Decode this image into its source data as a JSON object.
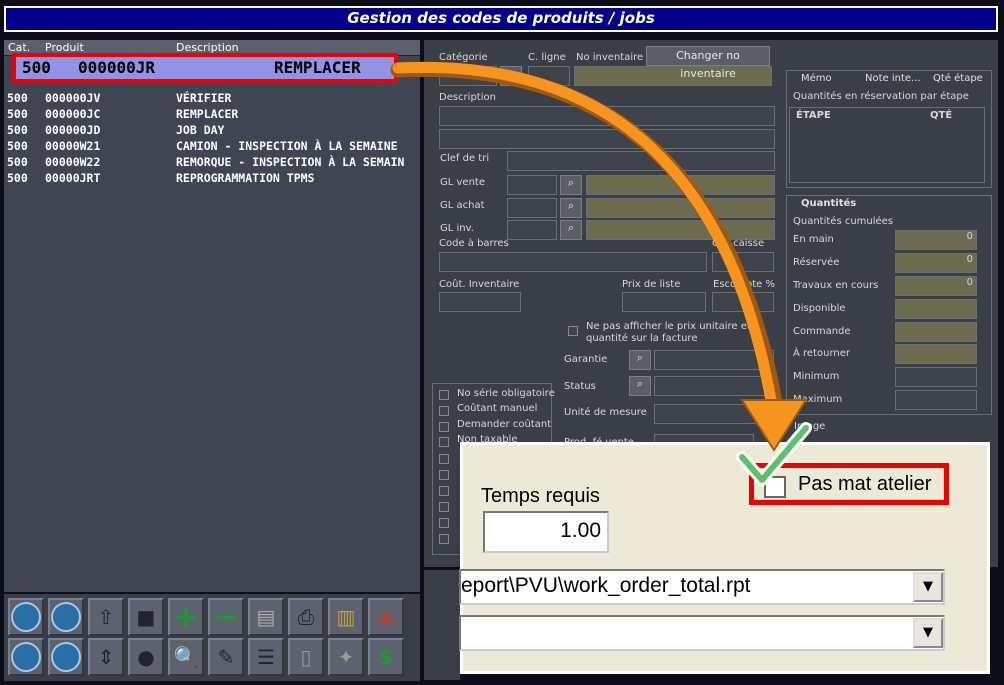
{
  "title": "Gestion des codes de produits / jobs",
  "list": {
    "headers": {
      "cat": "Cat.",
      "produit": "Produit",
      "description": "Description"
    },
    "selected": {
      "cat": "500",
      "produit": "000000JR",
      "description": "REMPLACER"
    },
    "rows": [
      {
        "cat": "500",
        "produit": "000000JV",
        "description": "VÉRIFIER"
      },
      {
        "cat": "500",
        "produit": "000000JC",
        "description": "REMPLACER"
      },
      {
        "cat": "500",
        "produit": "000000JD",
        "description": "JOB DAY"
      },
      {
        "cat": "500",
        "produit": "00000W21",
        "description": "CAMION - INSPECTION À LA SEMAINE"
      },
      {
        "cat": "500",
        "produit": "00000W22",
        "description": "REMORQUE - INSPECTION À LA SEMAIN"
      },
      {
        "cat": "500",
        "produit": "00000JRT",
        "description": "REPROGRAMMATION TPMS"
      }
    ]
  },
  "form": {
    "categorie": "Catégorie",
    "c_ligne": "C. ligne",
    "no_inventaire": "No inventaire",
    "changer_no_inventaire": "Changer no inventaire",
    "description": "Description",
    "clef_de_tri": "Clef de tri",
    "gl_vente": "GL vente",
    "gl_achat": "GL achat",
    "gl_inv": "GL inv.",
    "code_a_barres": "Code à barres",
    "qte_caisse": "Qté caisse",
    "cout_inventaire": "Coût. Inventaire",
    "prix_de_liste": "Prix de liste",
    "escompte": "Escompte %",
    "ne_pas_afficher": "Ne pas afficher le prix unitaire et la quantité sur la facture",
    "garantie": "Garantie",
    "status": "Status",
    "unite_de_mesure": "Unité de mesure",
    "prod_fe_vente": "Prod. fé vente"
  },
  "checkboxes": [
    "No série obligatoire",
    "Coûtant manuel",
    "Demander coûtant",
    "Non taxable"
  ],
  "tabs_top": [
    "Mémo",
    "Note inte...",
    "Qté étape"
  ],
  "etape": {
    "group_title": "Quantités en réservation par étape",
    "col_etape": "ÉTAPE",
    "col_qte": "QTÉ"
  },
  "tab_quantites": "Quantités",
  "quantites": {
    "group_title": "Quantités cumulées",
    "items": [
      {
        "label": "En main",
        "value": "0"
      },
      {
        "label": "Réservée",
        "value": "0"
      },
      {
        "label": "Travaux en cours",
        "value": "0"
      },
      {
        "label": "Disponible",
        "value": ""
      },
      {
        "label": "Commande",
        "value": ""
      },
      {
        "label": "À retourner",
        "value": ""
      },
      {
        "label": "Minimum",
        "value": ""
      },
      {
        "label": "Maximum",
        "value": ""
      }
    ]
  },
  "image_label": "Image",
  "zoom": {
    "temps_requis_label": "Temps requis",
    "temps_requis_value": "1.00",
    "pas_mat_atelier": "Pas mat atelier",
    "report_path": "eport\\PVU\\work_order_total.rpt",
    "second_dropdown": ""
  },
  "colors": {
    "title_bg": "#00008b",
    "highlight": "#e00000",
    "arrow": "#f7941d",
    "selected_row": "#9292e6"
  }
}
